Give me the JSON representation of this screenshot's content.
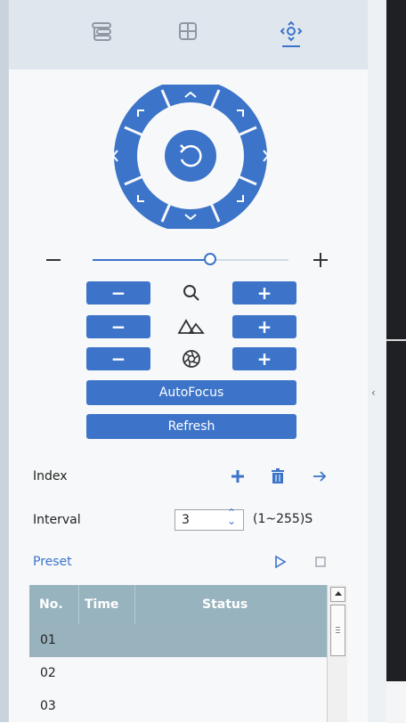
{
  "tabs": [
    {
      "name": "list-icon",
      "active": false
    },
    {
      "name": "grid-icon",
      "active": false
    },
    {
      "name": "ptz-icon",
      "active": true
    }
  ],
  "zoom_slider": {
    "value": 0.6
  },
  "lens_rows": [
    {
      "icon": "zoom-icon",
      "minus": "−",
      "plus": "+"
    },
    {
      "icon": "focus-icon",
      "minus": "−",
      "plus": "+"
    },
    {
      "icon": "iris-icon",
      "minus": "−",
      "plus": "+"
    }
  ],
  "buttons": {
    "autofocus": "AutoFocus",
    "refresh": "Refresh"
  },
  "index": {
    "label": "Index"
  },
  "interval": {
    "label": "Interval",
    "value": "3",
    "range": "(1~255)S"
  },
  "preset": {
    "label": "Preset"
  },
  "table": {
    "headers": [
      "No.",
      "Time",
      "Status"
    ],
    "rows": [
      {
        "no": "01"
      },
      {
        "no": "02"
      },
      {
        "no": "03"
      }
    ],
    "selected_row": 0
  },
  "colors": {
    "accent": "#3c74c9",
    "button": "#3d74c9",
    "table_header": "#97b3be"
  }
}
